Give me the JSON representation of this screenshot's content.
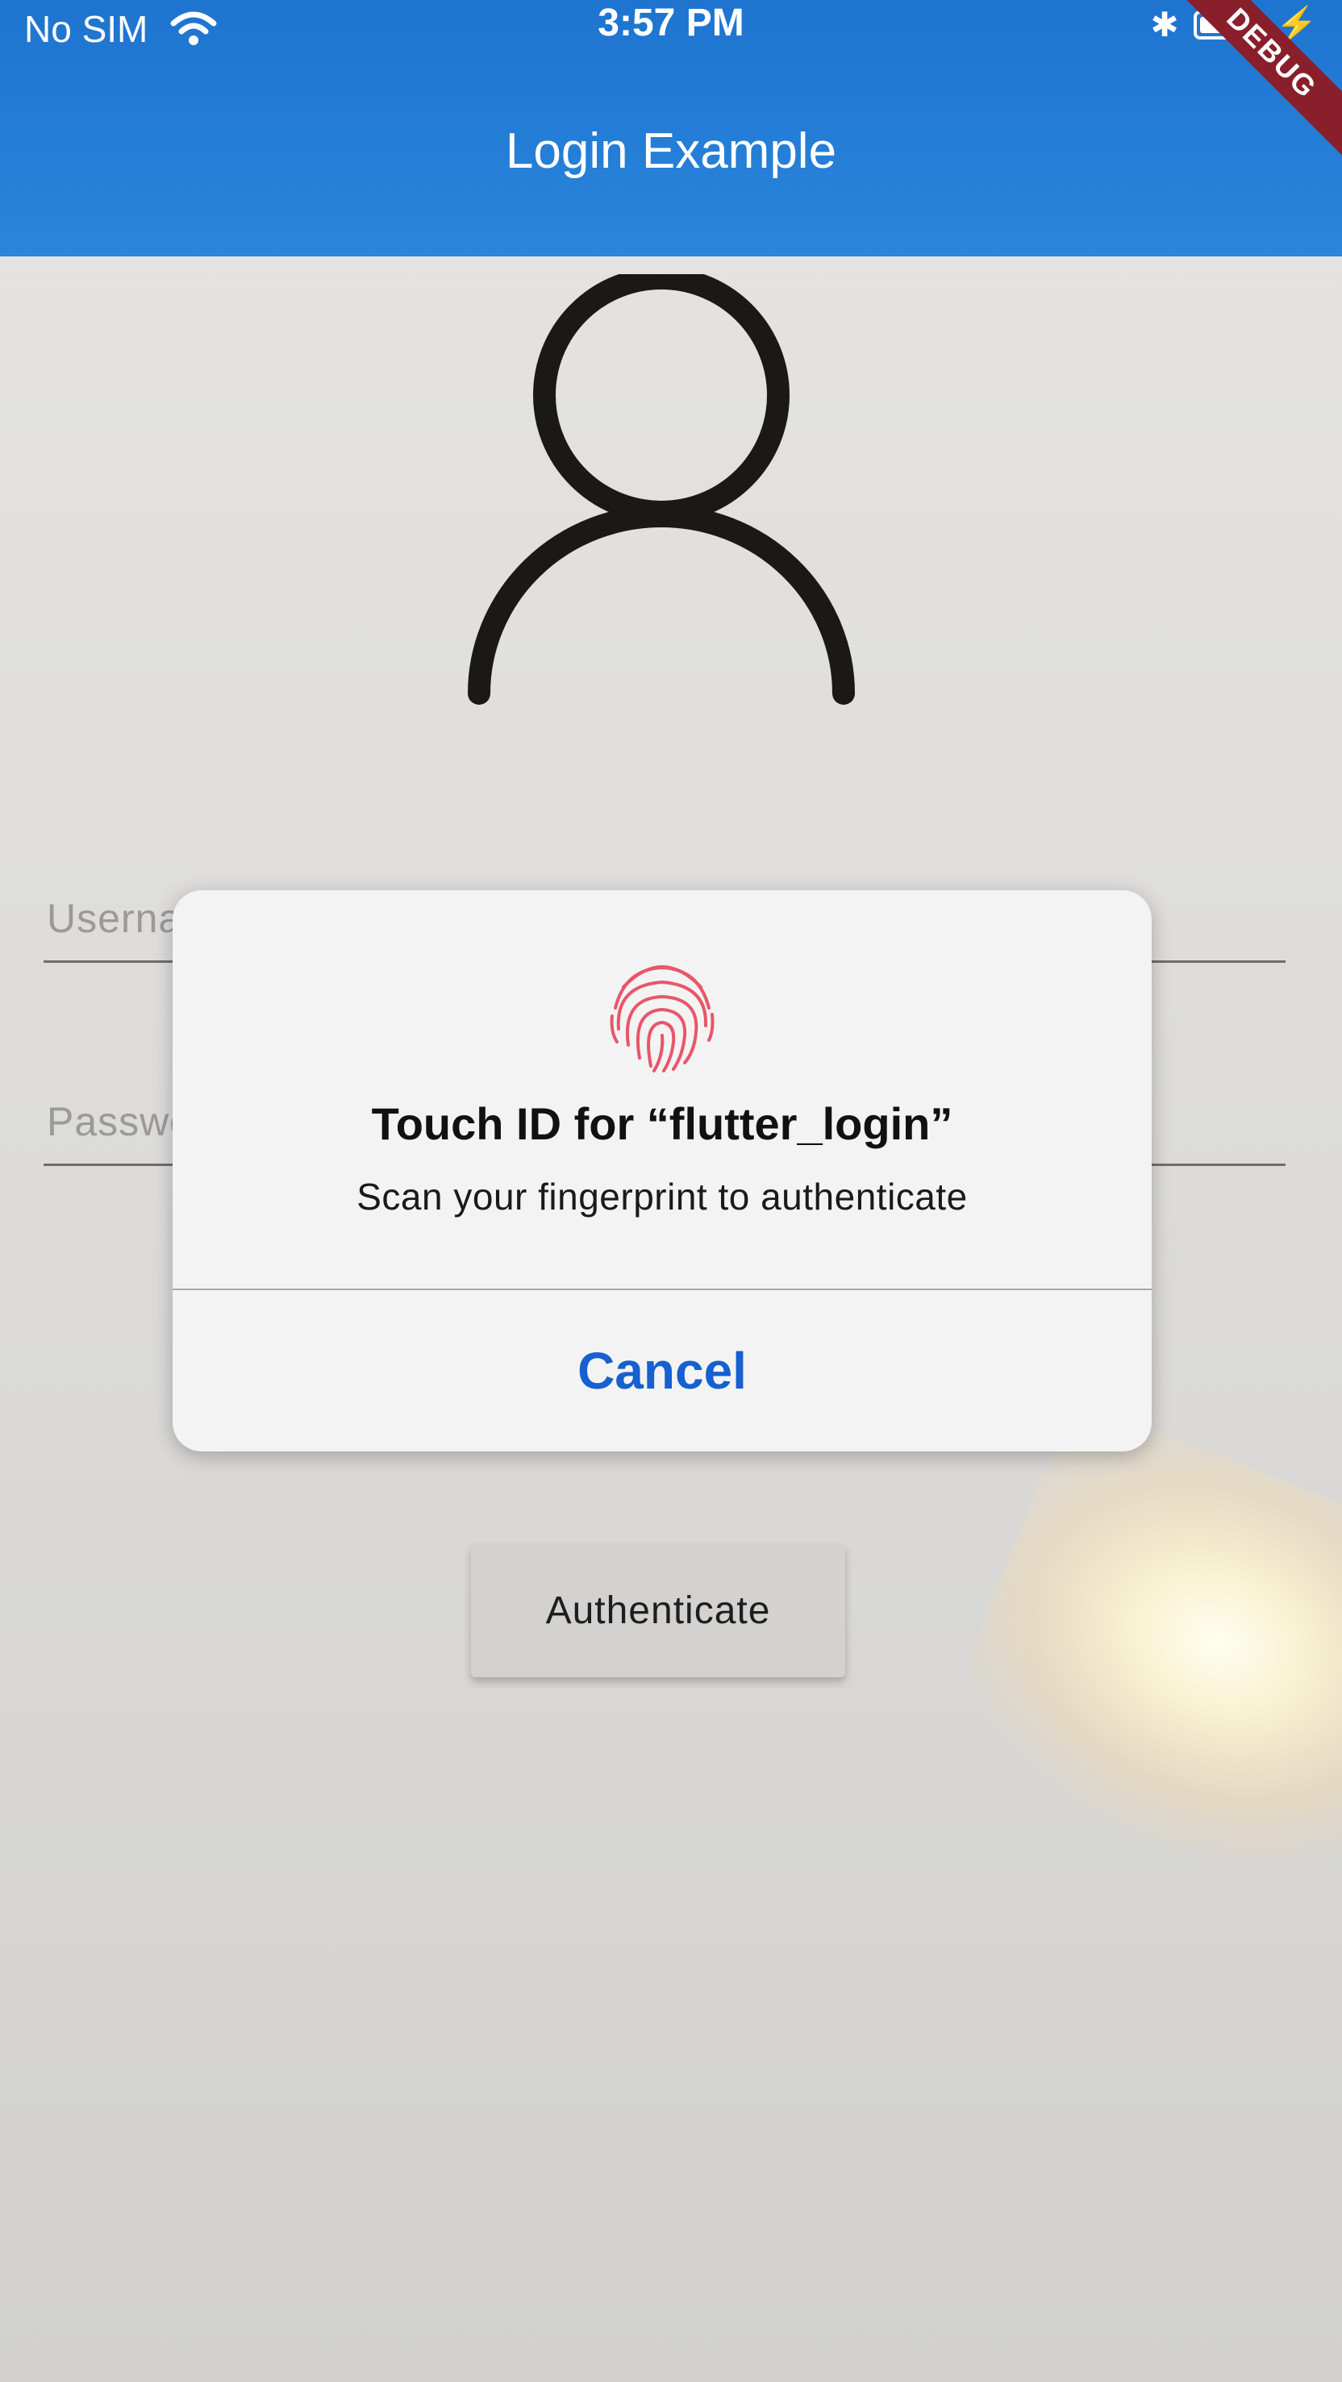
{
  "status_bar": {
    "carrier": "No SIM",
    "time": "3:57 PM",
    "bluetooth_glyph": "✱",
    "charging_glyph": "⚡"
  },
  "app_bar": {
    "title": "Login Example",
    "debug_banner": "DEBUG"
  },
  "form": {
    "username_label": "Username",
    "password_label": "Password",
    "authenticate_label": "Authenticate"
  },
  "alert": {
    "title": "Touch ID for “flutter_login”",
    "message": "Scan your fingerprint to authenticate",
    "cancel_label": "Cancel"
  },
  "colors": {
    "app_bar": "#1e74cf",
    "accent_link": "#1660cf",
    "debug_banner": "#8a1f2c",
    "fingerprint": "#e8566a"
  },
  "icons": [
    "wifi-icon",
    "bluetooth-icon",
    "battery-icon",
    "charging-icon",
    "person-icon",
    "fingerprint-icon"
  ]
}
